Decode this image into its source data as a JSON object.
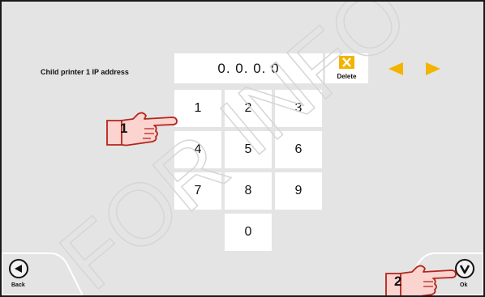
{
  "settings": {
    "ip_label": "Child printer 1 IP address",
    "ip_value": "0. 0. 0. 0",
    "delete_label": "Delete"
  },
  "keypad": {
    "keys": [
      "1",
      "2",
      "3",
      "4",
      "5",
      "6",
      "7",
      "8",
      "9",
      "0"
    ]
  },
  "footer": {
    "back_label": "Back",
    "ok_label": "Ok"
  },
  "callouts": {
    "one": "1",
    "two": "2"
  },
  "watermark": "FOR INFO",
  "colors": {
    "arrow": "#f3b400",
    "delete_icon": "#f3b400",
    "callout_fill": "#fbd3cf",
    "callout_stroke": "#b3251c"
  },
  "icons": [
    "delete-x-icon",
    "arrow-left-icon",
    "arrow-right-icon",
    "back-icon",
    "ok-check-icon",
    "pointing-hand-icon"
  ]
}
